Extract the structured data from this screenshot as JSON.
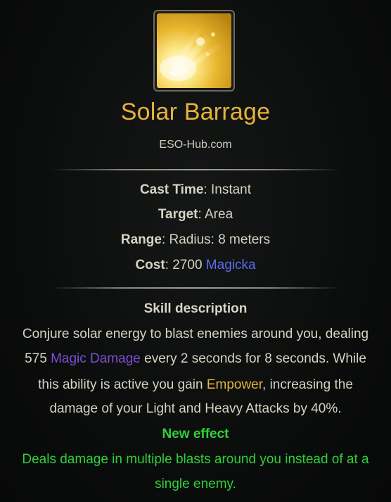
{
  "skill": {
    "name": "Solar Barrage",
    "source": "ESO-Hub.com",
    "icon": "solar-barrage-icon"
  },
  "stats": {
    "cast_time_label": "Cast Time",
    "cast_time_value": ": Instant",
    "target_label": "Target",
    "target_value": ": Area",
    "range_label": "Range",
    "range_value": ": Radius: 8 meters",
    "cost_label": "Cost",
    "cost_value": ": 2700 ",
    "cost_resource": "Magicka"
  },
  "description": {
    "heading": "Skill description",
    "line1": "Conjure solar energy to blast enemies around you, dealing",
    "line2_prefix": "575 ",
    "line2_highlight": "Magic Damage",
    "line2_suffix": " every 2 seconds for 8 seconds. While",
    "line3_prefix": "this ability is active you gain ",
    "line3_highlight": "Empower",
    "line3_suffix": ", increasing the",
    "line4": "damage of your Light and Heavy Attacks by 40%."
  },
  "new_effect": {
    "heading": "New effect",
    "line1": "Deals damage in multiple blasts around you instead of at a",
    "line2": "single enemy."
  },
  "colors": {
    "title": "#e6b23c",
    "magicka": "#5a6cf0",
    "magic_damage": "#7c4fd6",
    "empower": "#e6b23c",
    "new_effect": "#2fcf3a"
  }
}
